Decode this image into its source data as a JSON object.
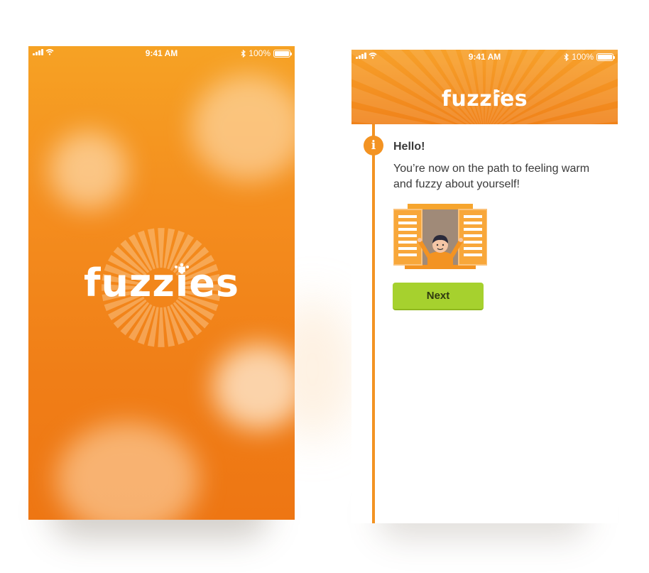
{
  "colors": {
    "brand_orange": "#f39322",
    "next_green": "#a6d12e",
    "text_dark": "#3a3a3a"
  },
  "splash_screen": {
    "status_bar": {
      "time": "9:41 AM",
      "battery": "100%",
      "icons": [
        "signal-icon",
        "wifi-icon",
        "bluetooth-icon",
        "battery-icon"
      ]
    },
    "logo_text": "fuzzies"
  },
  "onboarding_screen": {
    "status_bar": {
      "time": "9:41 AM",
      "battery": "100%",
      "icons": [
        "signal-icon",
        "wifi-icon",
        "bluetooth-icon",
        "battery-icon"
      ]
    },
    "header_logo": "fuzzies",
    "info_icon": "i",
    "message": {
      "title": "Hello!",
      "body": "You’re now on the path to feeling warm and fuzzy about yourself!"
    },
    "illustration": "person-waving-from-window-illustration",
    "next_button_label": "Next"
  }
}
